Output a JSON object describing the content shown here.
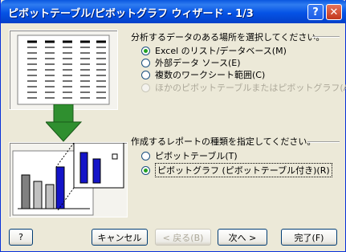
{
  "window": {
    "title": "ピボットテーブル/ピボットグラフ ウィザード - 1/3",
    "help_button": "?",
    "close_button": "✕"
  },
  "source_group": {
    "heading": "分析するデータのある場所を選択してください。",
    "options": [
      {
        "label": "Excel のリスト/データベース(M)",
        "selected": true,
        "enabled": true
      },
      {
        "label": "外部データ ソース(E)",
        "selected": false,
        "enabled": true
      },
      {
        "label": "複数のワークシート範囲(C)",
        "selected": false,
        "enabled": true
      },
      {
        "label": "ほかのピボットテーブルまたはピボットグラフ(A)",
        "selected": false,
        "enabled": false
      }
    ]
  },
  "report_group": {
    "heading": "作成するレポートの種類を指定してください。",
    "options": [
      {
        "label": "ピボットテーブル(T)",
        "selected": false,
        "enabled": true
      },
      {
        "label": "ピボットグラフ (ピボットテーブル付き)(R)",
        "selected": true,
        "enabled": true
      }
    ]
  },
  "buttons": {
    "help": "?",
    "cancel": "キャンセル",
    "back": "< 戻る(B)",
    "next": "次へ >",
    "finish": "完了(F)"
  },
  "colors": {
    "title_bar": "#0553e6",
    "arrow": "#2f8f2f",
    "bar_blue": "#1414c8",
    "bar_gray": "#808080",
    "radio_dot": "#21a121"
  }
}
